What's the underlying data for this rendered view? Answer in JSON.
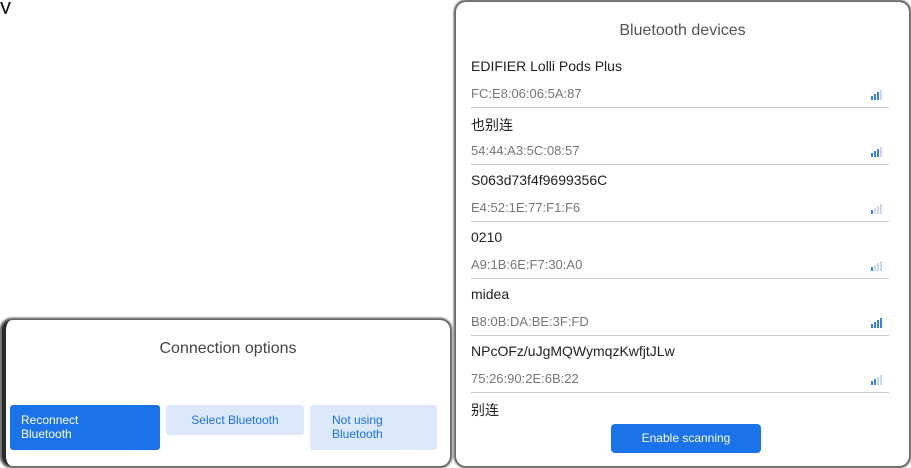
{
  "background": {
    "partial_text": "y"
  },
  "connection_dialog": {
    "title": "Connection options",
    "buttons": {
      "reconnect": "Reconnect\nBluetooth",
      "select": "Select Bluetooth",
      "not_using": "Not using\nBluetooth"
    }
  },
  "bluetooth_dialog": {
    "title": "Bluetooth devices",
    "devices": [
      {
        "name": "EDIFIER Lolli Pods Plus",
        "address": "FC:E8:06:06:5A:87",
        "signal_bars": 3
      },
      {
        "name": "也别连",
        "address": "54:44:A3:5C:08:57",
        "signal_bars": 3
      },
      {
        "name": "S063d73f4f9699356C",
        "address": "E4:52:1E:77:F1:F6",
        "signal_bars": 1
      },
      {
        "name": "0210",
        "address": "A9:1B:6E:F7:30:A0",
        "signal_bars": 1
      },
      {
        "name": "midea",
        "address": "B8:0B:DA:BE:3F:FD",
        "signal_bars": 4
      },
      {
        "name": "NPcOFz/uJgMQWymqzKwfjtJLw",
        "address": "75:26:90:2E:6B:22",
        "signal_bars": 2
      },
      {
        "name": "别连"
      }
    ],
    "scan_button": "Enable scanning"
  },
  "colors": {
    "primary": "#1a73e8",
    "secondary_bg": "#dce9fb",
    "signal_on": "#3b82e6",
    "signal_off": "#c9d9f2"
  }
}
